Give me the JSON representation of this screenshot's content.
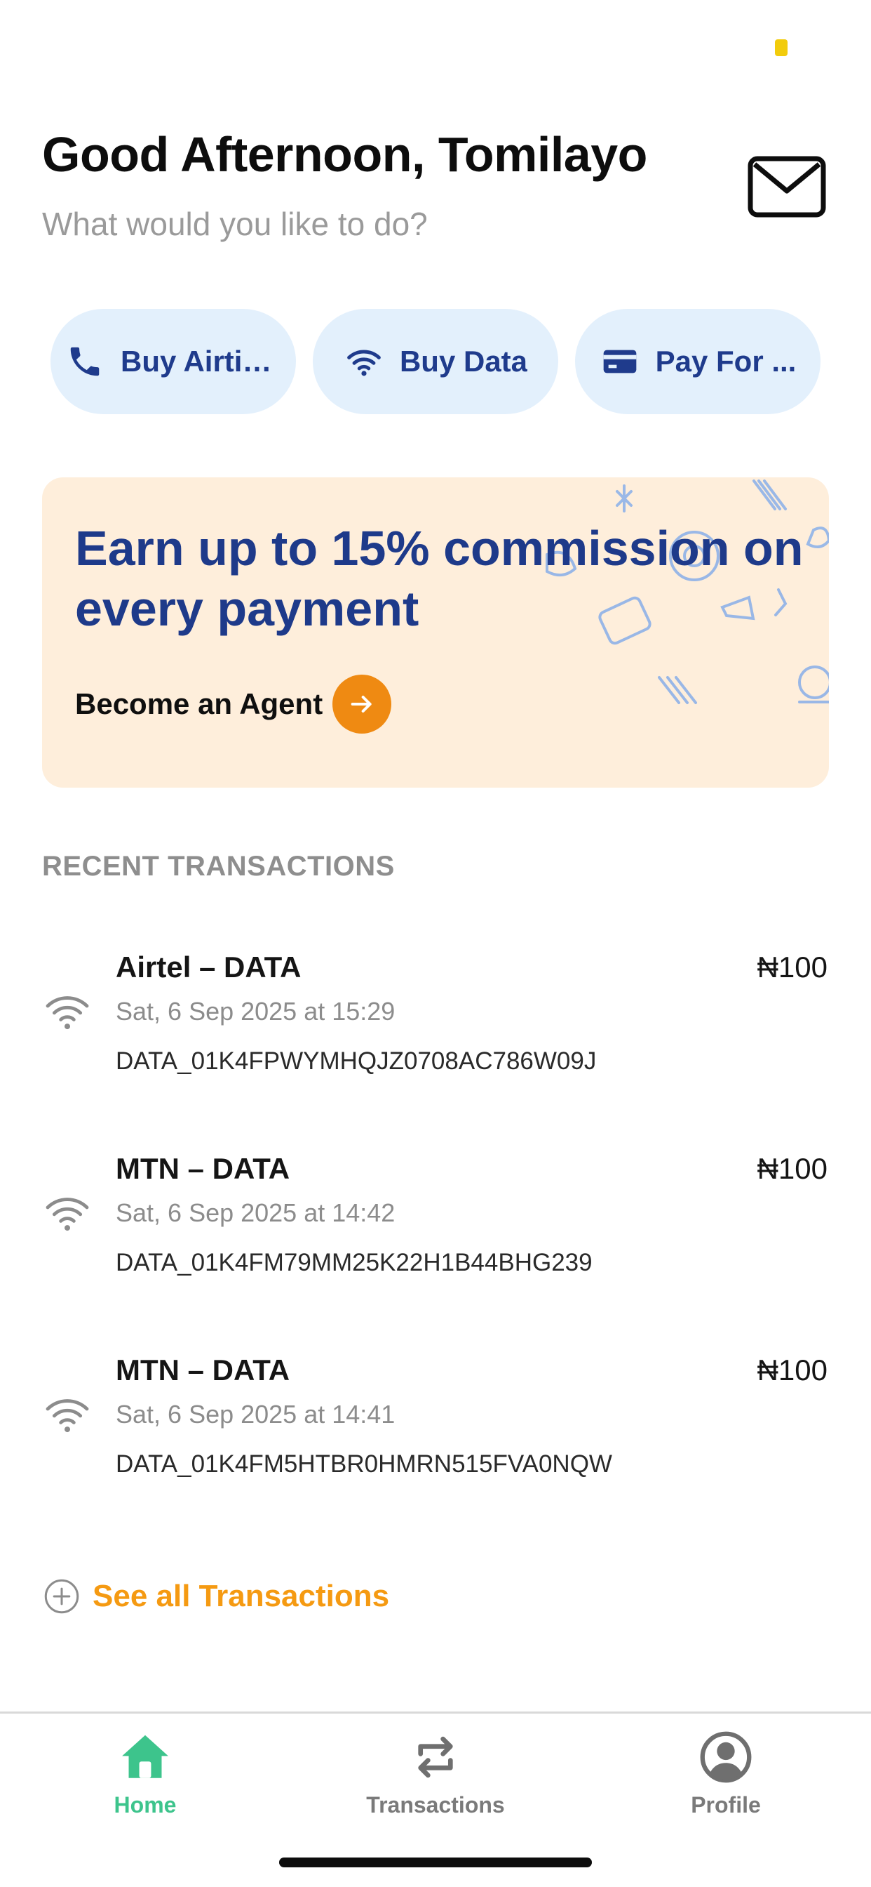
{
  "header": {
    "greeting": "Good Afternoon, Tomilayo",
    "subtitle": "What would you like to do?",
    "mail_icon": "envelope-icon"
  },
  "quick_actions": [
    {
      "label": "Buy Airtime",
      "icon": "phone-icon"
    },
    {
      "label": "Buy Data",
      "icon": "wifi-icon"
    },
    {
      "label": "Pay For ...",
      "icon": "card-icon"
    }
  ],
  "promo": {
    "title": "Earn up to 15% commission on every payment",
    "cta_label": "Become an Agent",
    "cta_icon": "arrow-right-icon",
    "background_color": "#FEEEDB",
    "accent_color": "#EF8A12"
  },
  "recent": {
    "section_title": "RECENT TRANSACTIONS",
    "transactions": [
      {
        "title": "Airtel – DATA",
        "date": "Sat, 6 Sep 2025 at 15:29",
        "reference": "DATA_01K4FPWYMHQJZ0708AC786W09J",
        "amount": "₦100",
        "icon": "wifi-icon"
      },
      {
        "title": "MTN – DATA",
        "date": "Sat, 6 Sep 2025 at 14:42",
        "reference": "DATA_01K4FM79MM25K22H1B44BHG239",
        "amount": "₦100",
        "icon": "wifi-icon"
      },
      {
        "title": "MTN – DATA",
        "date": "Sat, 6 Sep 2025 at 14:41",
        "reference": "DATA_01K4FM5HTBR0HMRN515FVA0NQW",
        "amount": "₦100",
        "icon": "wifi-icon"
      }
    ],
    "see_all_label": "See all Transactions"
  },
  "tabbar": {
    "tabs": [
      {
        "label": "Home",
        "icon": "home-icon",
        "active": true
      },
      {
        "label": "Transactions",
        "icon": "repeat-icon",
        "active": false
      },
      {
        "label": "Profile",
        "icon": "user-circle-icon",
        "active": false
      }
    ]
  },
  "colors": {
    "brand_blue": "#1E3A8A",
    "chip_background": "#E3F0FC",
    "link_orange": "#F59A12",
    "active_tab_green": "#3DC48C"
  }
}
